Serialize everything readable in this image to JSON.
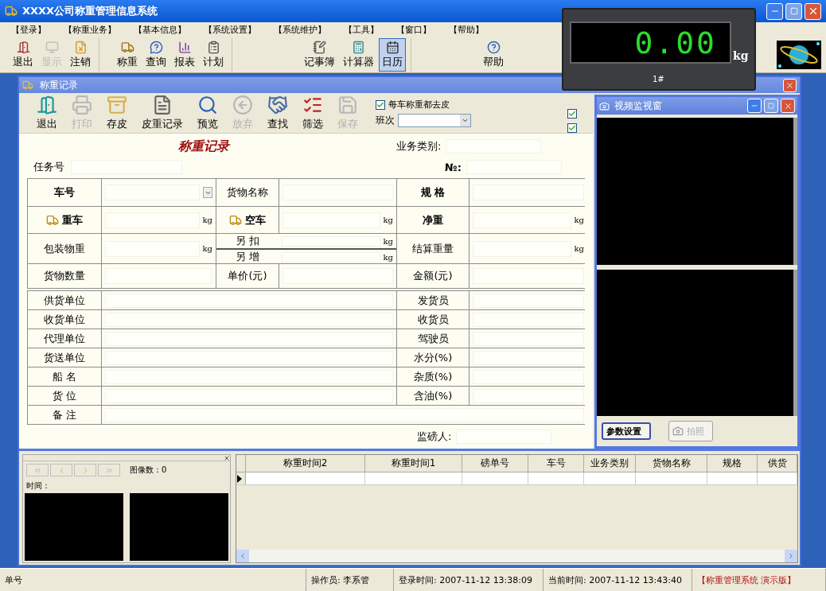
{
  "window": {
    "title": "XXXX公司称重管理信息系统"
  },
  "menu": [
    "【登录】",
    "【称重业务】",
    "【基本信息】",
    "【系统设置】",
    "【系统维护】",
    "【工具】",
    "【窗口】",
    "【帮助】"
  ],
  "toolbar": {
    "groups": [
      [
        {
          "label": "退出",
          "disabled": false,
          "selected": false
        },
        {
          "label": "显示",
          "disabled": true,
          "selected": false
        },
        {
          "label": "注销",
          "disabled": false,
          "selected": false
        }
      ],
      [
        {
          "label": "称重",
          "disabled": false,
          "selected": false
        },
        {
          "label": "查询",
          "disabled": false,
          "selected": false
        },
        {
          "label": "报表",
          "disabled": false,
          "selected": false
        },
        {
          "label": "计划",
          "disabled": false,
          "selected": false
        }
      ],
      [
        {
          "label": "记事簿",
          "disabled": false,
          "selected": false
        },
        {
          "label": "计算器",
          "disabled": false,
          "selected": false
        },
        {
          "label": "日历",
          "disabled": false,
          "selected": true
        }
      ],
      [
        {
          "label": "帮助",
          "disabled": false,
          "selected": false
        }
      ]
    ]
  },
  "scale": {
    "reading": "0.00",
    "unit": "kg",
    "station": "1#"
  },
  "record_window": {
    "title": "称重记录",
    "toolbar": [
      {
        "label": "退出",
        "disabled": false
      },
      {
        "label": "打印",
        "disabled": true
      },
      {
        "label": "存皮",
        "disabled": false
      },
      {
        "label": "皮重记录",
        "disabled": false
      },
      {
        "label": "预览",
        "disabled": false
      },
      {
        "label": "放弃",
        "disabled": true
      },
      {
        "label": "查找",
        "disabled": false
      },
      {
        "label": "筛选",
        "disabled": false
      },
      {
        "label": "保存",
        "disabled": true
      }
    ],
    "tare_check": {
      "label": "每车称重都去皮",
      "checked": true
    },
    "shift": {
      "label": "班次"
    },
    "side_checks": [
      {
        "checked": true
      },
      {
        "checked": true
      }
    ],
    "form": {
      "title": "称重记录",
      "business_type": {
        "label": "业务类别:"
      },
      "task": {
        "label": "任务号"
      },
      "number": {
        "label": "№:"
      },
      "supervisor": {
        "label": "监磅人:"
      },
      "upper": [
        [
          {
            "kind": "label",
            "text": "车号",
            "strong": true
          },
          {
            "kind": "dropdown"
          },
          {
            "kind": "label",
            "text": "货物名称",
            "strong": false
          },
          {
            "kind": "field"
          },
          {
            "kind": "label",
            "text": "规 格",
            "strong": true
          },
          {
            "kind": "field"
          }
        ],
        [
          {
            "kind": "truck_label",
            "text": "重车",
            "strong": true
          },
          {
            "kind": "field",
            "unit": "kg"
          },
          {
            "kind": "truck_label",
            "text": "空车",
            "strong": true
          },
          {
            "kind": "field",
            "unit": "kg"
          },
          {
            "kind": "label",
            "text": "净重",
            "strong": true
          },
          {
            "kind": "field",
            "unit": "kg"
          }
        ],
        [
          {
            "kind": "label",
            "text": "包装物重",
            "strong": false
          },
          {
            "kind": "field",
            "unit": "kg"
          },
          {
            "kind": "split",
            "parts": [
              {
                "text": "另 扣",
                "unit": "kg"
              },
              {
                "text": "另 增",
                "unit": "kg"
              }
            ]
          },
          {
            "kind": "label",
            "text": "结算重量",
            "strong": false
          },
          {
            "kind": "field",
            "unit": "kg"
          }
        ],
        [
          {
            "kind": "label",
            "text": "货物数量",
            "strong": false
          },
          {
            "kind": "field"
          },
          {
            "kind": "label",
            "text": "单价(元)",
            "strong": false
          },
          {
            "kind": "field"
          },
          {
            "kind": "label",
            "text": "金额(元)",
            "strong": false
          },
          {
            "kind": "field"
          }
        ]
      ],
      "lower": [
        {
          "left": "供货单位",
          "right": "发货员"
        },
        {
          "left": "收货单位",
          "right": "收货员"
        },
        {
          "left": "代理单位",
          "right": "驾驶员"
        },
        {
          "left": "货送单位",
          "right": "水分(%)"
        },
        {
          "left": "船 名",
          "right": "杂质(%)"
        },
        {
          "left": "货 位",
          "right": "含油(%)"
        },
        {
          "left": "备 注"
        }
      ]
    }
  },
  "video_window": {
    "title": "视频监视窗",
    "buttons": [
      {
        "label": "参数设置",
        "disabled": false
      },
      {
        "label": "拍照",
        "disabled": true
      }
    ]
  },
  "image_panel": {
    "nav_buttons": [
      {
        "disabled": true
      },
      {
        "disabled": true
      },
      {
        "disabled": true
      },
      {
        "disabled": true
      }
    ],
    "count_label": "图像数：0",
    "time_label": "时间："
  },
  "grid": {
    "columns": [
      "称重时间2",
      "称重时间1",
      "磅单号",
      "车号",
      "业务类别",
      "货物名称",
      "规格",
      "供货"
    ],
    "rows": [
      {
        "current": true
      }
    ]
  },
  "status_bar": [
    {
      "kind": "text",
      "text": "单号"
    },
    {
      "kind": "text",
      "text": "操作员: 李系管"
    },
    {
      "kind": "text",
      "text": "登录时间: 2007-11-12 13:38:09"
    },
    {
      "kind": "text",
      "text": "当前时间: 2007-11-12 13:43:40"
    },
    {
      "kind": "brand",
      "text": "【称重管理系统 演示版】"
    }
  ]
}
